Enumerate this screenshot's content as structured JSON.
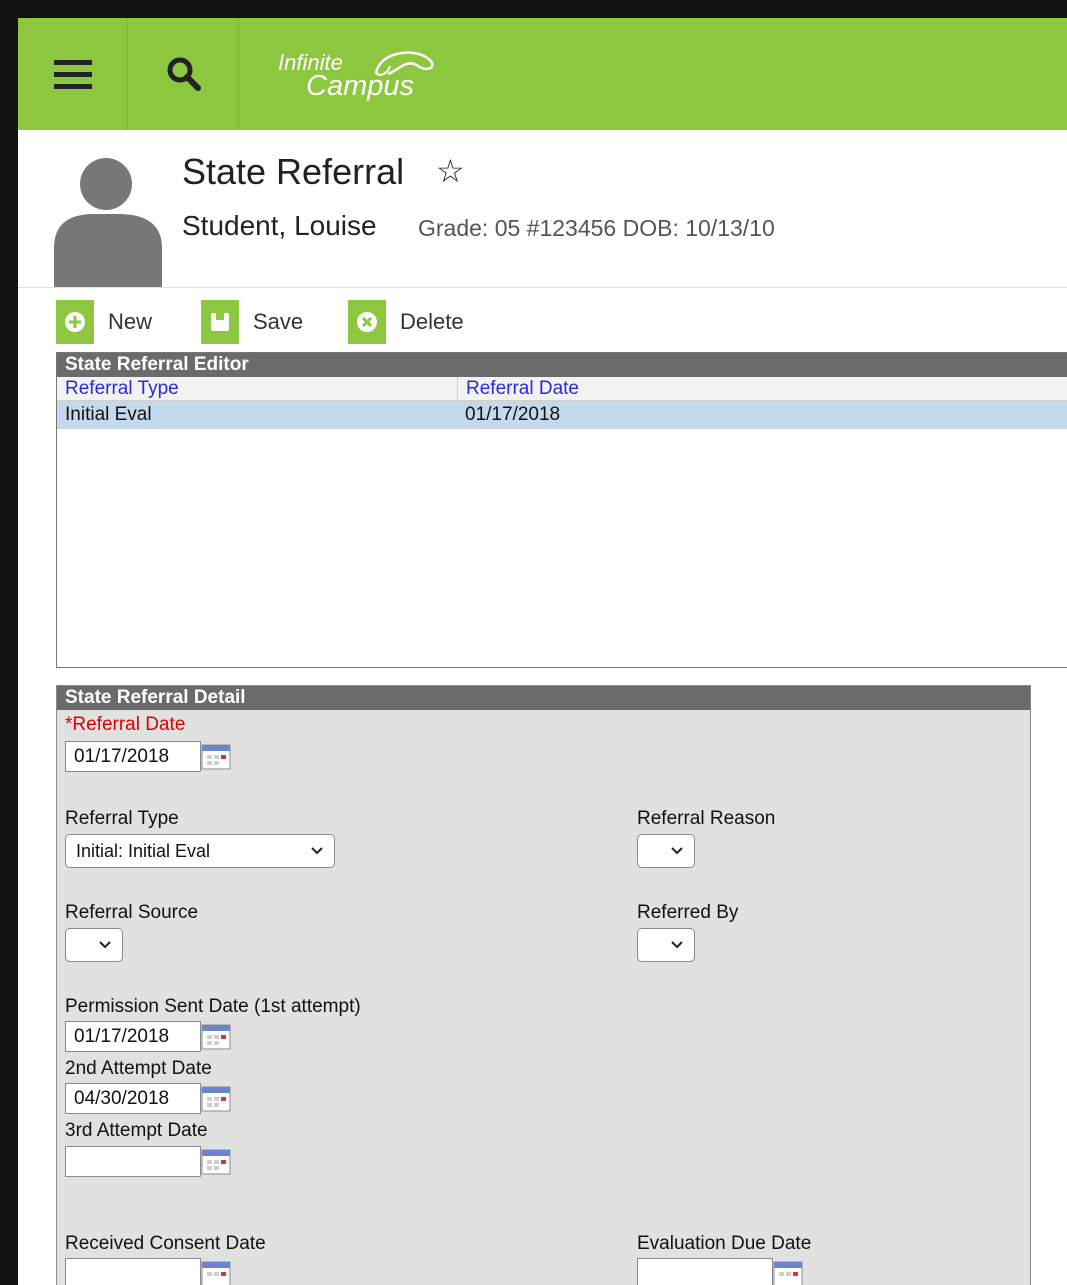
{
  "app": {
    "logo_line1": "Infinite",
    "logo_line2": "Campus"
  },
  "header": {
    "title": "State Referral",
    "student_name": "Student, Louise",
    "student_meta": "Grade: 05 #123456 DOB: 10/13/10"
  },
  "toolbar": {
    "new_label": "New",
    "save_label": "Save",
    "delete_label": "Delete"
  },
  "editor": {
    "title": "State Referral Editor",
    "columns": [
      "Referral Type",
      "Referral Date"
    ],
    "rows": [
      {
        "type": "Initial Eval",
        "date": "01/17/2018"
      }
    ]
  },
  "detail": {
    "title": "State Referral Detail",
    "referral_date": {
      "label": "*Referral Date",
      "value": "01/17/2018"
    },
    "referral_type": {
      "label": "Referral Type",
      "value": "Initial: Initial Eval"
    },
    "referral_reason": {
      "label": "Referral Reason",
      "value": ""
    },
    "referral_source": {
      "label": "Referral Source",
      "value": ""
    },
    "referred_by": {
      "label": "Referred By",
      "value": ""
    },
    "permission_sent": {
      "label": "Permission Sent Date (1st attempt)",
      "value": "01/17/2018"
    },
    "second_attempt": {
      "label": "2nd Attempt Date",
      "value": "04/30/2018"
    },
    "third_attempt": {
      "label": "3rd Attempt Date",
      "value": ""
    },
    "received_consent": {
      "label": "Received Consent Date",
      "value": ""
    },
    "evaluation_due": {
      "label": "Evaluation Due Date",
      "value": ""
    }
  },
  "colors": {
    "brand_green": "#8dc63f",
    "required_red": "#e00000",
    "link_blue": "#2a2adf",
    "selected_row": "#c5d9ec"
  }
}
